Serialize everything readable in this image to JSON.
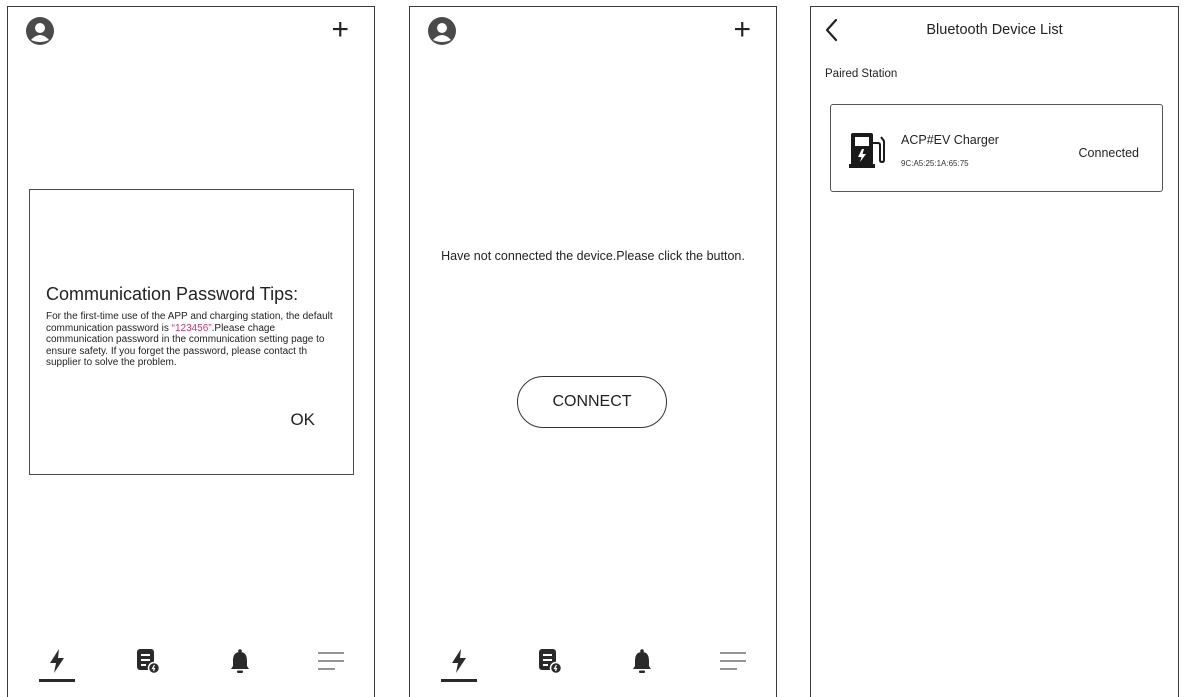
{
  "screen1": {
    "dialog": {
      "title": "Communication Password Tips:",
      "body_before": "For the first-time use of the APP  and charging station, the default communication password is ",
      "password": "“123456”",
      "body_after": ".Please chage communication password in the communication setting page to ensure safety. If you forget the password, please contact th supplier to solve the problem.",
      "ok_label": "OK"
    }
  },
  "screen2": {
    "notice": "Have not connected the device.Please click the button.",
    "connect_label": "CONNECT"
  },
  "screen3": {
    "header_title": "Bluetooth Device List",
    "section_label": "Paired Station",
    "device": {
      "name": "ACP#EV Charger",
      "mac": "9C:A5:25:1A:65:75",
      "status": "Connected"
    }
  },
  "nav": {
    "items": [
      "charging-icon",
      "records-icon",
      "bell-icon",
      "menu-icon"
    ],
    "active_index": 0
  },
  "colors": {
    "password_highlight": "#d6336c",
    "icon_fill": "#2a2a2a"
  }
}
